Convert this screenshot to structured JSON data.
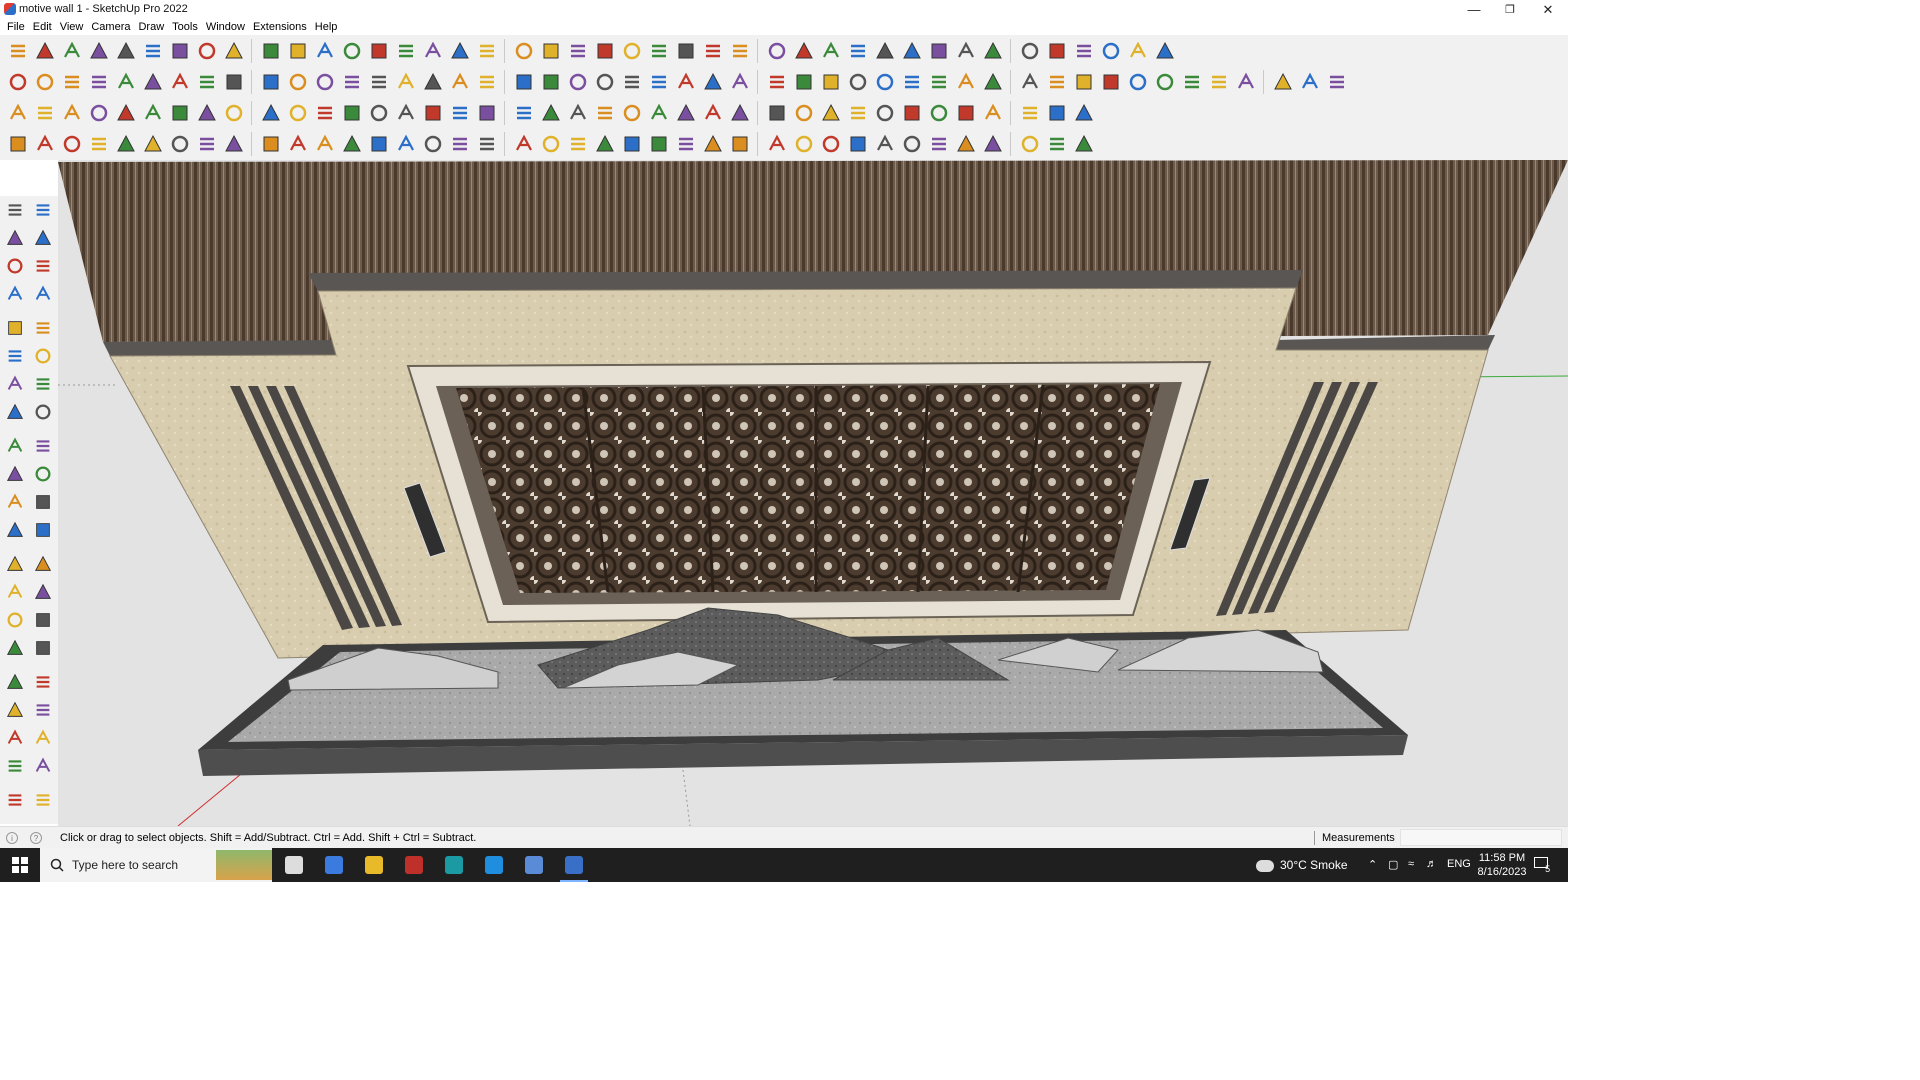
{
  "window": {
    "title": "motive wall 1 - SketchUp Pro 2022",
    "app_icon": "sketchup-icon"
  },
  "window_controls": {
    "minimize": "—",
    "restore": "❐",
    "close": "✕"
  },
  "menu": [
    "File",
    "Edit",
    "View",
    "Camera",
    "Draw",
    "Tools",
    "Window",
    "Extensions",
    "Help"
  ],
  "toolbar_icons": {
    "row1": [
      "zoom-icon",
      "select-icon",
      "eraser-icon",
      "line-icon",
      "arc-icon",
      "rectangle-icon",
      "push-pull-icon",
      "follow-me-icon",
      "move-icon",
      "rotate-icon",
      "scale-icon",
      "tape-measure-icon",
      "text-icon",
      "paint-bucket-icon",
      "orbit-icon",
      "pan-icon",
      "zoom-window-icon",
      "zoom-extents-icon",
      "section-plane-icon",
      "layers-icon",
      "warehouse-icon",
      "extension-icon"
    ],
    "row2": [
      "component-icon",
      "material-icon",
      "style-icon",
      "push-icon",
      "extrude-icon",
      "shape-icon",
      "grass-icon",
      "house-icon",
      "curve-icon",
      "pipe-icon"
    ],
    "row3": [
      "cube-icon",
      "flip-icon",
      "round-corner-icon",
      "grid-icon",
      "weld-icon",
      "join-icon",
      "joint-push-pull-icon",
      "bezier-icon"
    ],
    "row4": [
      "draw-icon",
      "spline-icon",
      "car-icon",
      "stair-icon",
      "profile-icon",
      "window-icon"
    ]
  },
  "left_tools": [
    "select-icon",
    "lasso-icon",
    "paint-bucket-icon",
    "eraser-icon",
    "dimension-icon",
    "pencil-icon",
    "line-icon",
    "freehand-icon",
    "rectangle-icon",
    "rotated-rectangle-icon",
    "circle-icon",
    "polygon-icon",
    "arc-icon",
    "two-point-arc-icon",
    "three-point-arc-icon",
    "pie-icon",
    "move-icon",
    "push-pull-icon",
    "rotate-icon",
    "follow-me-icon",
    "scale-icon",
    "offset-icon",
    "tape-measure-icon",
    "dimension-icon",
    "protractor-icon",
    "text-icon",
    "axes-icon",
    "3d-text-icon",
    "orbit-icon",
    "pan-icon",
    "zoom-icon",
    "zoom-window-icon",
    "zoom-extents-icon",
    "previous-view-icon",
    "position-camera-icon",
    "look-around-icon",
    "walk-icon",
    "section-plane-icon",
    "outliner-icon",
    "scenes-icon",
    "layers-icon",
    "display-section-icon"
  ],
  "colors": {
    "accent": "#2b6fc9",
    "toolbar_bg": "#f1f1f1",
    "viewport_bg": "#e3e3e3",
    "taskbar_bg": "#1f1f1f"
  },
  "status": {
    "hint": "Click or drag to select objects. Shift = Add/Subtract. Ctrl = Add. Shift + Ctrl = Subtract.",
    "measurements_label": "Measurements",
    "measurements_value": ""
  },
  "taskbar": {
    "search_placeholder": "Type here to search",
    "weather": "30°C  Smoke",
    "language": "ENG",
    "time": "11:58 PM",
    "date": "8/16/2023",
    "notification_count": "5",
    "apps": [
      "task-view-icon",
      "calculator-icon",
      "file-explorer-icon",
      "acrobat-icon",
      "3ds-max-icon",
      "edge-icon",
      "snipping-tool-icon",
      "sketchup-icon"
    ]
  }
}
